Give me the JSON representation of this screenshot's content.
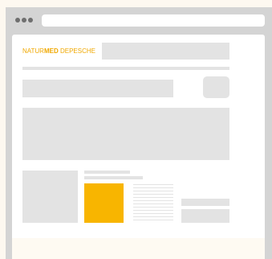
{
  "logo": {
    "part1": "NATUR",
    "part2": "MED",
    "part3": " DEPESCHE"
  },
  "colors": {
    "accent": "#f8b500",
    "placeholder": "#e3e3e3",
    "frame": "#d4d4d4",
    "background": "#fdf8f0"
  },
  "icons": {
    "window_dots": "traffic-dots-icon"
  }
}
